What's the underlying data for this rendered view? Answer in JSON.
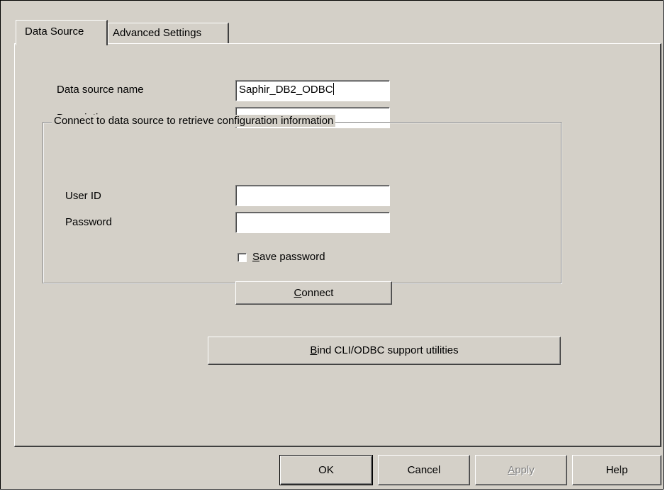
{
  "tabs": {
    "data_source": "Data Source",
    "advanced_settings": "Advanced Settings"
  },
  "form": {
    "data_source_name_label": "Data source name",
    "data_source_name_value": "Saphir_DB2_ODBC",
    "description_label": "Description",
    "description_value": ""
  },
  "connect_group": {
    "legend": "Connect to data source to retrieve configuration information",
    "user_id_label": "User ID",
    "user_id_value": "",
    "password_label": "Password",
    "password_value": "",
    "save_password": {
      "mnemonic": "S",
      "rest": "ave password",
      "checked": false
    },
    "connect_button": {
      "mnemonic": "C",
      "rest": "onnect"
    }
  },
  "bind_button": {
    "mnemonic": "B",
    "rest": "ind CLI/ODBC support utilities"
  },
  "footer": {
    "ok": "OK",
    "cancel": "Cancel",
    "apply_mnemonic": "A",
    "apply_rest": "pply",
    "help": "Help"
  },
  "colors": {
    "dialog_background": "#d4d0c8",
    "disabled_text": "#808080"
  }
}
